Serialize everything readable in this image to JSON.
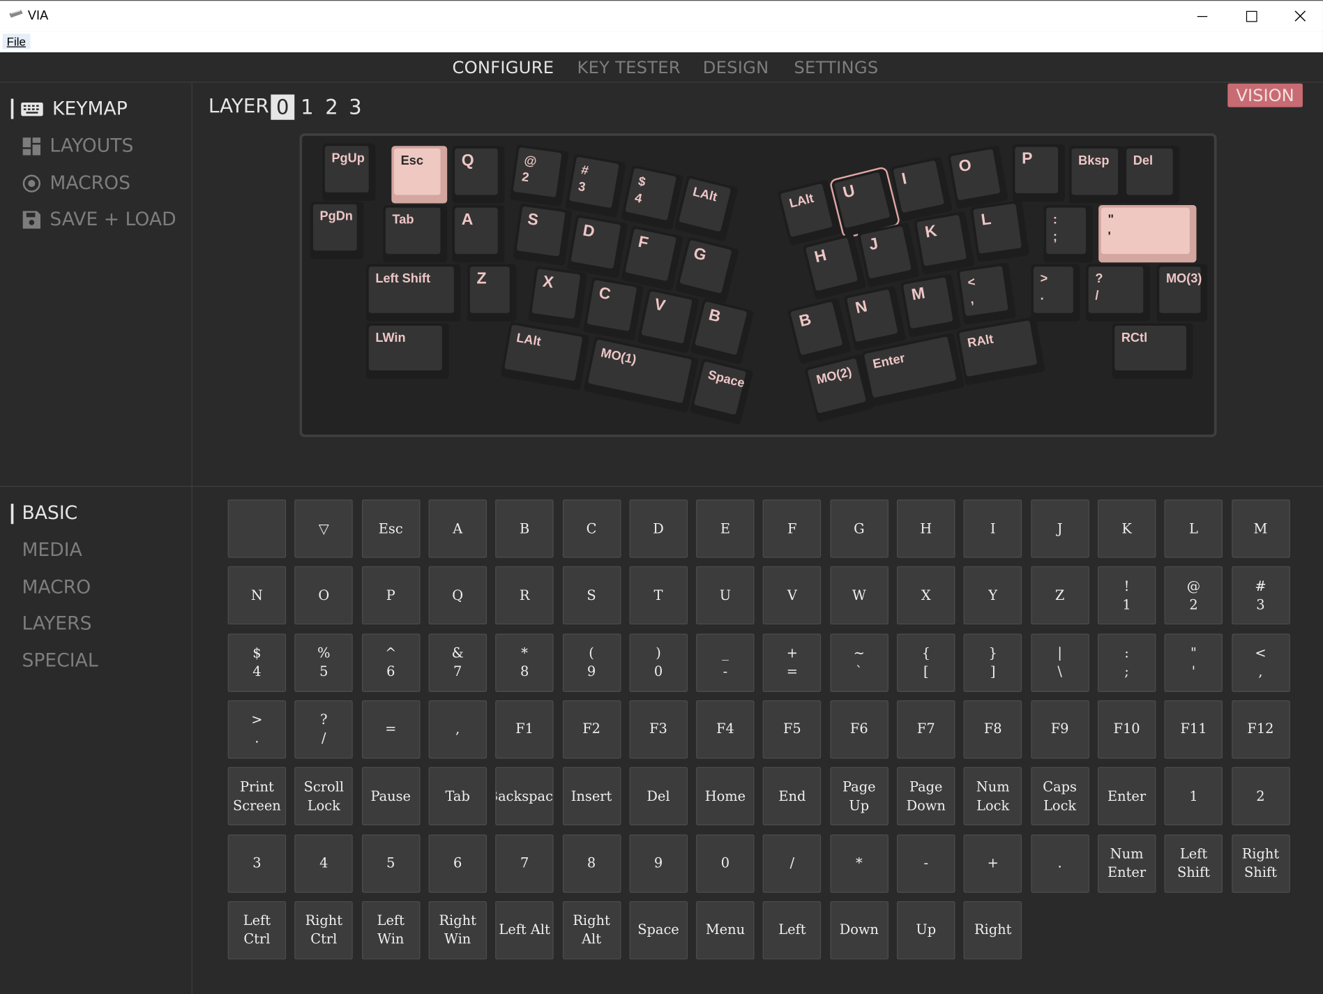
{
  "window": {
    "title": "VIA"
  },
  "menu": {
    "file": "File"
  },
  "nav": {
    "tabs": [
      "CONFIGURE",
      "KEY TESTER",
      "DESIGN",
      "SETTINGS"
    ]
  },
  "sidebar_top": {
    "items": [
      "KEYMAP",
      "LAYOUTS",
      "MACROS",
      "SAVE + LOAD"
    ]
  },
  "sidebar_bottom": {
    "items": [
      "BASIC",
      "MEDIA",
      "MACRO",
      "LAYERS",
      "SPECIAL"
    ]
  },
  "layer": {
    "label": "LAYER",
    "numbers": [
      "0",
      "1",
      "2",
      "3"
    ]
  },
  "badge": {
    "label": "VISION"
  },
  "colors": {
    "accent": "#c86b72",
    "selected_key": "#efc8c2",
    "legend": "#efc6c6"
  },
  "keyboard": {
    "keys": [
      "PgUp",
      "Esc",
      "Q",
      "@\n2",
      "#\n3",
      "$\n4",
      "LAlt",
      "PgDn",
      "Tab",
      "A",
      "S",
      "D",
      "F",
      "G",
      "Left Shift",
      "Z",
      "X",
      "C",
      "V",
      "B",
      "LWin",
      "LAlt",
      "MO(1)",
      "Space",
      "LAlt",
      "U",
      "I",
      "O",
      "P",
      "Bksp",
      "Del",
      "H",
      "J",
      "K",
      "L",
      ":\n;",
      "\"\n'",
      "B",
      "N",
      "M",
      "<\n,",
      ">\n.",
      "?\n/",
      "MO(3)",
      "MO(2)",
      "Enter",
      "RAlt",
      "RCtl"
    ]
  },
  "keycodes": {
    "rows": [
      [
        "",
        "▽",
        "Esc",
        "A",
        "B",
        "C",
        "D",
        "E",
        "F",
        "G",
        "H",
        "I",
        "J",
        "K",
        "L",
        "M"
      ],
      [
        "N",
        "O",
        "P",
        "Q",
        "R",
        "S",
        "T",
        "U",
        "V",
        "W",
        "X",
        "Y",
        "Z",
        "!\n1",
        "@\n2",
        "#\n3"
      ],
      [
        "$\n4",
        "%\n5",
        "^\n6",
        "&\n7",
        "*\n8",
        "(\n9",
        ")\n0",
        "_\n-",
        "+\n=",
        "~\n`",
        "{\n[",
        "}\n]",
        "|\n\\",
        ":\n;",
        "\"\n'",
        "<\n,"
      ],
      [
        ">\n.",
        "?\n/",
        "=",
        ",",
        "F1",
        "F2",
        "F3",
        "F4",
        "F5",
        "F6",
        "F7",
        "F8",
        "F9",
        "F10",
        "F11",
        "F12"
      ],
      [
        "Print\nScreen",
        "Scroll\nLock",
        "Pause",
        "Tab",
        "Backspace",
        "Insert",
        "Del",
        "Home",
        "End",
        "Page Up",
        "Page\nDown",
        "Num\nLock",
        "Caps\nLock",
        "Enter",
        "1",
        "2"
      ],
      [
        "3",
        "4",
        "5",
        "6",
        "7",
        "8",
        "9",
        "0",
        "/",
        "*",
        "-",
        "+",
        ".",
        "Num\nEnter",
        "Left\nShift",
        "Right\nShift"
      ],
      [
        "Left Ctrl",
        "Right\nCtrl",
        "Left Win",
        "Right\nWin",
        "Left Alt",
        "Right Alt",
        "Space",
        "Menu",
        "Left",
        "Down",
        "Up",
        "Right"
      ]
    ]
  }
}
